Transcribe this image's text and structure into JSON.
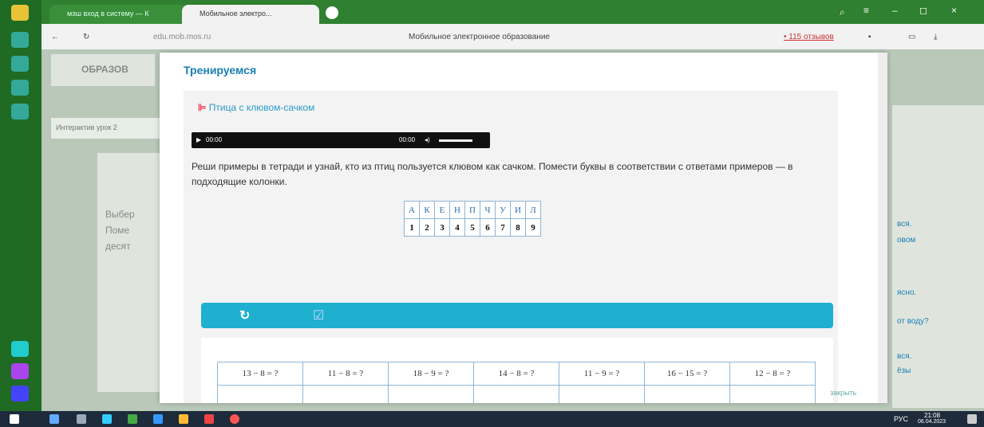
{
  "browser": {
    "tabs": [
      {
        "label": "мэш вход в систему — К"
      },
      {
        "label": "Мобильное электро..."
      }
    ],
    "url": "edu.mob.mos.ru",
    "page_title": "Мобильное электронное образование",
    "badge": "• 115 отзывов"
  },
  "background_page": {
    "logo_text": "ОБРАЗОВ",
    "lesson_text": "Интерактив урок 2",
    "left_text": [
      "Выбер",
      "Поме",
      "десят"
    ],
    "right_text": [
      "вся.",
      "овом",
      "ясно.",
      "от воду?",
      "вся.",
      "ёзы"
    ]
  },
  "modal": {
    "title": "Тренируемся",
    "task_title": "Птица с клювом-сачком",
    "audio": {
      "time_start": "00:00",
      "time_end": "00:00"
    },
    "instruction": "Реши примеры в тетради и узнай, кто из птиц пользуется клювом как сачком. Помести буквы в соответствии с ответами примеров — в подходящие колонки.",
    "key_letters": [
      "А",
      "К",
      "Е",
      "Н",
      "П",
      "Ч",
      "У",
      "И",
      "Л"
    ],
    "key_numbers": [
      "1",
      "2",
      "3",
      "4",
      "5",
      "6",
      "7",
      "8",
      "9"
    ],
    "answer_headers": [
      "13 − 8 = ?",
      "11 − 8 = ?",
      "18 − 9 = ?",
      "14 − 8 = ?",
      "11 − 9 = ?",
      "16 − 15 = ?",
      "12 − 8 = ?"
    ],
    "close_label": "закрыть"
  },
  "taskbar": {
    "language": "РУС",
    "time": "21:08",
    "date": "06.04.2023"
  }
}
